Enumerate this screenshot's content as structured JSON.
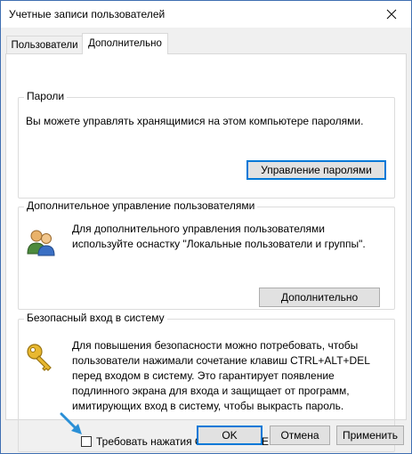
{
  "window": {
    "title": "Учетные записи пользователей"
  },
  "tabs": [
    {
      "label": "Пользователи"
    },
    {
      "label": "Дополнительно"
    }
  ],
  "passwords": {
    "title": "Пароли",
    "text": "Вы можете управлять хранящимися на этом компьютере паролями.",
    "button": "Управление паролями"
  },
  "advanced_users": {
    "title": "Дополнительное управление пользователями",
    "text_line1": "Для дополнительного управления пользователями",
    "text_line2": "используйте оснастку \"Локальные пользователи и группы\".",
    "button": "Дополнительно"
  },
  "secure_logon": {
    "title": "Безопасный вход в систему",
    "lines": [
      "Для повышения безопасности можно потребовать, чтобы",
      "пользователи нажимали сочетание клавиш CTRL+ALT+DEL",
      "перед входом в систему. Это гарантирует появление",
      "подлинного экрана для входа и защищает от программ,",
      "имитирующих вход в систему, чтобы выкрасть пароль."
    ],
    "checkbox_label": "Требовать нажатия CTRL+ALT+DELETE",
    "checkbox_checked": false
  },
  "footer": {
    "ok": "OK",
    "cancel": "Отмена",
    "apply": "Применить"
  },
  "colors": {
    "accent": "#0078d7",
    "arrow": "#2a8fd6"
  },
  "icons": [
    "close-icon",
    "users-icon",
    "key-icon",
    "arrow-pointer-icon"
  ]
}
